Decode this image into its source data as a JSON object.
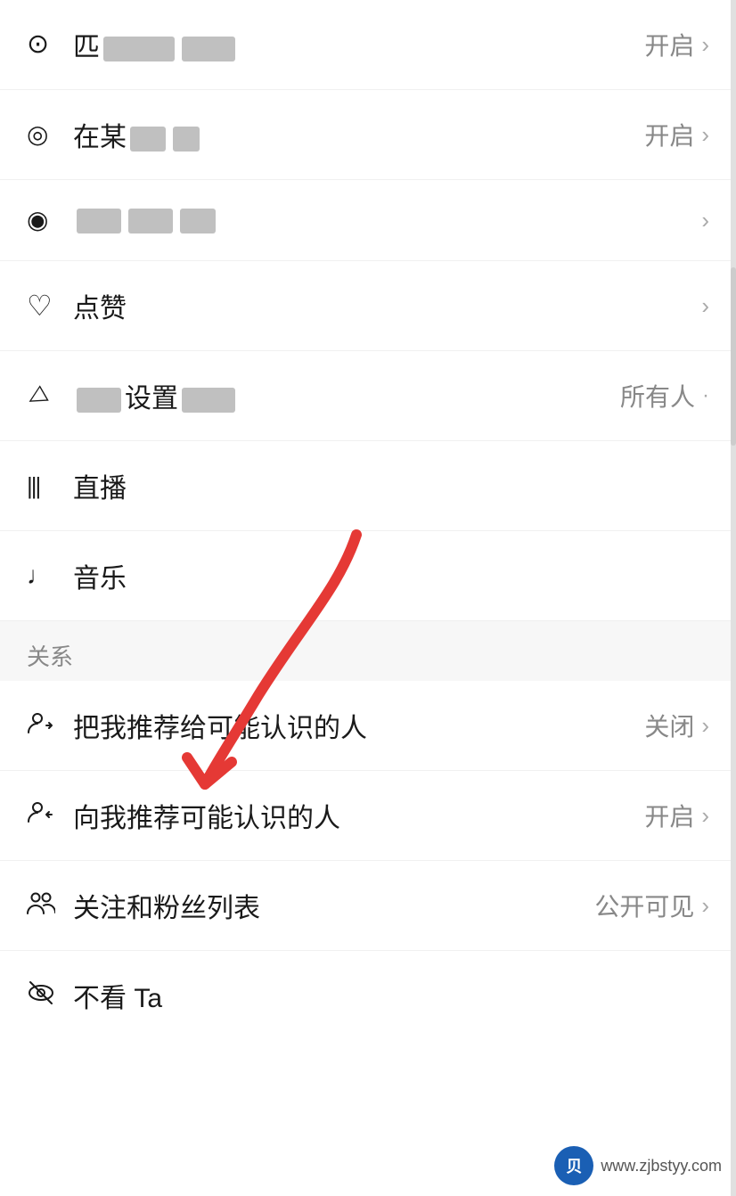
{
  "items": [
    {
      "id": "location",
      "icon": "📍",
      "icon_name": "location-icon",
      "label_prefix": "匹",
      "label_blurred": true,
      "value": "开启",
      "has_chevron": true
    },
    {
      "id": "nearby",
      "icon": "◎",
      "icon_name": "nearby-icon",
      "label_prefix": "在某",
      "label_blurred": true,
      "value": "开启",
      "has_chevron": true
    },
    {
      "id": "watch",
      "icon": "👁",
      "icon_name": "watch-icon",
      "label_prefix": "",
      "label_blurred": true,
      "value": "",
      "has_chevron": true
    },
    {
      "id": "like",
      "icon": "♡",
      "icon_name": "like-icon",
      "label": "点赞",
      "label_blurred": false,
      "value": "",
      "has_chevron": true
    },
    {
      "id": "share",
      "icon": "✈",
      "icon_name": "share-icon",
      "label_prefix": "设置",
      "label_blurred": true,
      "value": "所有人",
      "has_chevron": true
    },
    {
      "id": "live",
      "icon": "📊",
      "icon_name": "live-icon",
      "label": "直播",
      "label_blurred": false,
      "value": "",
      "has_chevron": false
    },
    {
      "id": "music",
      "icon": "♪",
      "icon_name": "music-icon",
      "label": "音乐",
      "label_blurred": false,
      "value": "",
      "has_chevron": false
    }
  ],
  "section": {
    "label": "关系"
  },
  "relation_items": [
    {
      "id": "recommend-to",
      "icon": "👤+",
      "icon_name": "recommend-to-icon",
      "label": "把我推荐给可能认识的人",
      "value": "关闭",
      "has_chevron": true,
      "highlighted": true
    },
    {
      "id": "recommend-from",
      "icon": "👤↩",
      "icon_name": "recommend-from-icon",
      "label": "向我推荐可能认识的人",
      "value": "开启",
      "has_chevron": true
    },
    {
      "id": "fans-list",
      "icon": "👥",
      "icon_name": "fans-list-icon",
      "label": "关注和粉丝列表",
      "value": "公开可见",
      "has_chevron": true
    },
    {
      "id": "no-see",
      "icon": "🚫👁",
      "icon_name": "no-see-icon",
      "label": "不看 Ta",
      "value": "",
      "has_chevron": false
    }
  ],
  "arrow_annotation": {
    "visible": true
  },
  "watermark": {
    "text": "www.zjbstyy.com",
    "logo_text": "贝"
  }
}
